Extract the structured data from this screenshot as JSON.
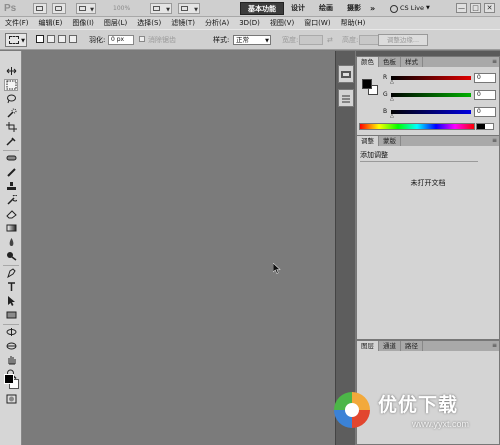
{
  "app": {
    "logo": "Ps",
    "zoom": "100%"
  },
  "workspaces": [
    "基本功能",
    "设计",
    "绘画",
    "摄影"
  ],
  "workspace_more": "»",
  "cs_live": "CS Live",
  "window_controls": [
    "—",
    "□",
    "✕"
  ],
  "menu": [
    "文件(F)",
    "编辑(E)",
    "图像(I)",
    "图层(L)",
    "选择(S)",
    "滤镜(T)",
    "分析(A)",
    "3D(D)",
    "视图(V)",
    "窗口(W)",
    "帮助(H)"
  ],
  "options": {
    "feather_label": "羽化:",
    "feather_value": "0 px",
    "antialias_label": "消除锯齿",
    "style_label": "样式:",
    "style_value": "正常",
    "width_label": "宽度:",
    "swap_icon": "⇄",
    "height_label": "高度:",
    "refine_button": "调整边缘..."
  },
  "tools": [
    "move-tool",
    "rect-marquee-tool",
    "lasso-tool",
    "quick-select-tool",
    "crop-tool",
    "eyedropper-tool",
    "spot-healing-tool",
    "brush-tool",
    "clone-stamp-tool",
    "history-brush-tool",
    "eraser-tool",
    "gradient-tool",
    "blur-tool",
    "dodge-tool",
    "pen-tool",
    "type-tool",
    "path-select-tool",
    "shape-tool",
    "3d-rotate-tool",
    "3d-orbit-tool",
    "hand-tool",
    "zoom-tool"
  ],
  "colors": {
    "foreground": "#000000",
    "background": "#ffffff",
    "active_workspace": "#3c3c3c"
  },
  "color_panel": {
    "tabs": [
      "颜色",
      "色板",
      "样式"
    ],
    "channels": [
      {
        "label": "R",
        "value": "0",
        "gradient": "#e00000"
      },
      {
        "label": "G",
        "value": "0",
        "gradient": "#00b000"
      },
      {
        "label": "B",
        "value": "0",
        "gradient": "#0000e0"
      }
    ]
  },
  "adjust_panel": {
    "tabs": [
      "调整",
      "蒙版"
    ],
    "title": "添加调整",
    "message": "未打开文档"
  },
  "layers_panel": {
    "tabs": [
      "图层",
      "通道",
      "路径"
    ]
  },
  "watermark": {
    "text": "优优下载",
    "url": "www.yyxt.com"
  }
}
